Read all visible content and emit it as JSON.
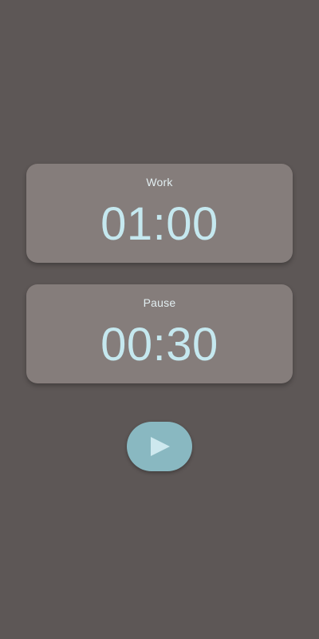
{
  "timers": {
    "work": {
      "label": "Work",
      "time": "01:00"
    },
    "pause": {
      "label": "Pause",
      "time": "00:30"
    }
  },
  "controls": {
    "start_icon": "play-icon"
  },
  "colors": {
    "background": "#5d5756",
    "card": "#857d7b",
    "text_accent": "#c5e8ef",
    "button": "#89b8c1"
  }
}
